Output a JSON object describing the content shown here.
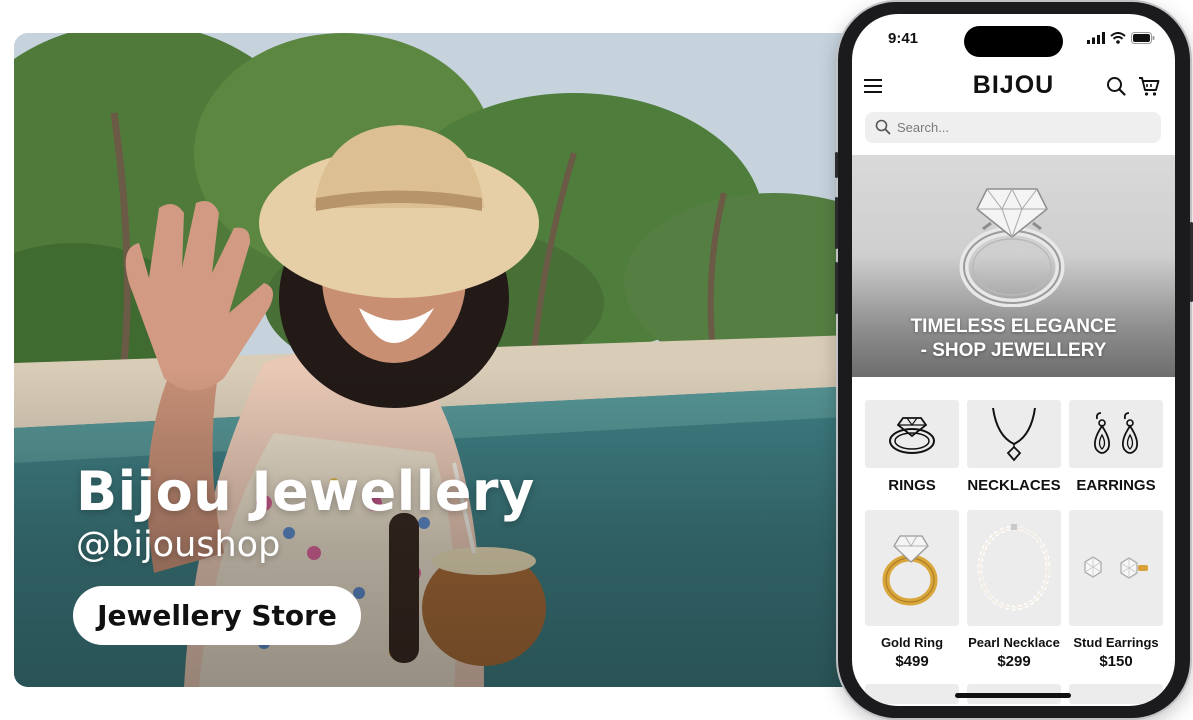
{
  "hero": {
    "brand_name": "Bijou Jewellery",
    "handle": "@bijoushop",
    "category_pill": "Jewellery Store"
  },
  "phone": {
    "status_bar": {
      "time": "9:41",
      "icons": [
        "signal-icon",
        "wifi-icon",
        "battery-icon"
      ]
    },
    "header": {
      "logo": "BIJOU",
      "icons": [
        "menu-icon",
        "search-icon",
        "cart-icon"
      ]
    },
    "search": {
      "placeholder": "Search..."
    },
    "banner": {
      "line1": "TIMELESS ELEGANCE",
      "line2": "- SHOP JEWELLERY"
    },
    "categories": [
      {
        "label": "RINGS",
        "icon": "ring-outline-icon"
      },
      {
        "label": "NECKLACES",
        "icon": "necklace-outline-icon"
      },
      {
        "label": "EARRINGS",
        "icon": "earrings-outline-icon"
      }
    ],
    "products": [
      {
        "name": "Gold Ring",
        "price": "$499"
      },
      {
        "name": "Pearl Necklace",
        "price": "$299"
      },
      {
        "name": "Stud Earrings",
        "price": "$150"
      }
    ]
  },
  "colors": {
    "tile_bg": "#ececec",
    "text": "#111111",
    "pill_bg": "#ffffff"
  }
}
